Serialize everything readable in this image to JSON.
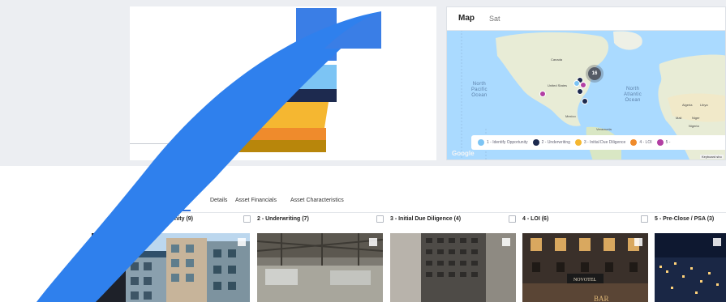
{
  "colors": {
    "swoosh_blue": "#2f80ed",
    "stage1": "#7cc4f4",
    "stage2": "#1d2a4f",
    "stage3": "#f5b731",
    "stage4": "#ef8b2c",
    "stage5": "#b23fa3",
    "active_tab": "#2f6fd8"
  },
  "map": {
    "tab_map": "Map",
    "tab_other": "Sat",
    "ocean_pacific": "North\nPacific\nOcean",
    "ocean_atlantic": "North\nAtlantic\nOcean",
    "land_labels": [
      "Canada",
      "United States",
      "Mexico",
      "Venezuela",
      "Algeria",
      "Libya",
      "Mali",
      "Niger",
      "Nigeria"
    ],
    "cluster_count": "16",
    "google_logo": "Google",
    "keyboard_note": "Keyboard sho",
    "legend": [
      {
        "label": "1 - Identify Opportunity",
        "color": "#7cc4f4"
      },
      {
        "label": "2 - Underwriting",
        "color": "#1d2a4f"
      },
      {
        "label": "3 - Initial Due Diligence",
        "color": "#f5b731"
      },
      {
        "label": "4 - LOI",
        "color": "#ef8b2c"
      },
      {
        "label": "5 -",
        "color": "#b23fa3"
      }
    ]
  },
  "tabs": [
    {
      "label": "kdown",
      "active": true
    },
    {
      "label": "Details",
      "active": false
    },
    {
      "label": "Asset Financials",
      "active": false
    },
    {
      "label": "Asset Characteristics",
      "active": false
    }
  ],
  "stages": [
    {
      "label": "tify Opportunity (9)"
    },
    {
      "label": "2 - Underwriting (7)"
    },
    {
      "label": "3 - Initial Due Diligence (4)"
    },
    {
      "label": "4 - LOI (6)"
    },
    {
      "label": "5 - Pre-Close / PSA (3)"
    }
  ],
  "photos": {
    "hotel_sign": "NOVOTEL",
    "bar_sign": "BAR"
  }
}
